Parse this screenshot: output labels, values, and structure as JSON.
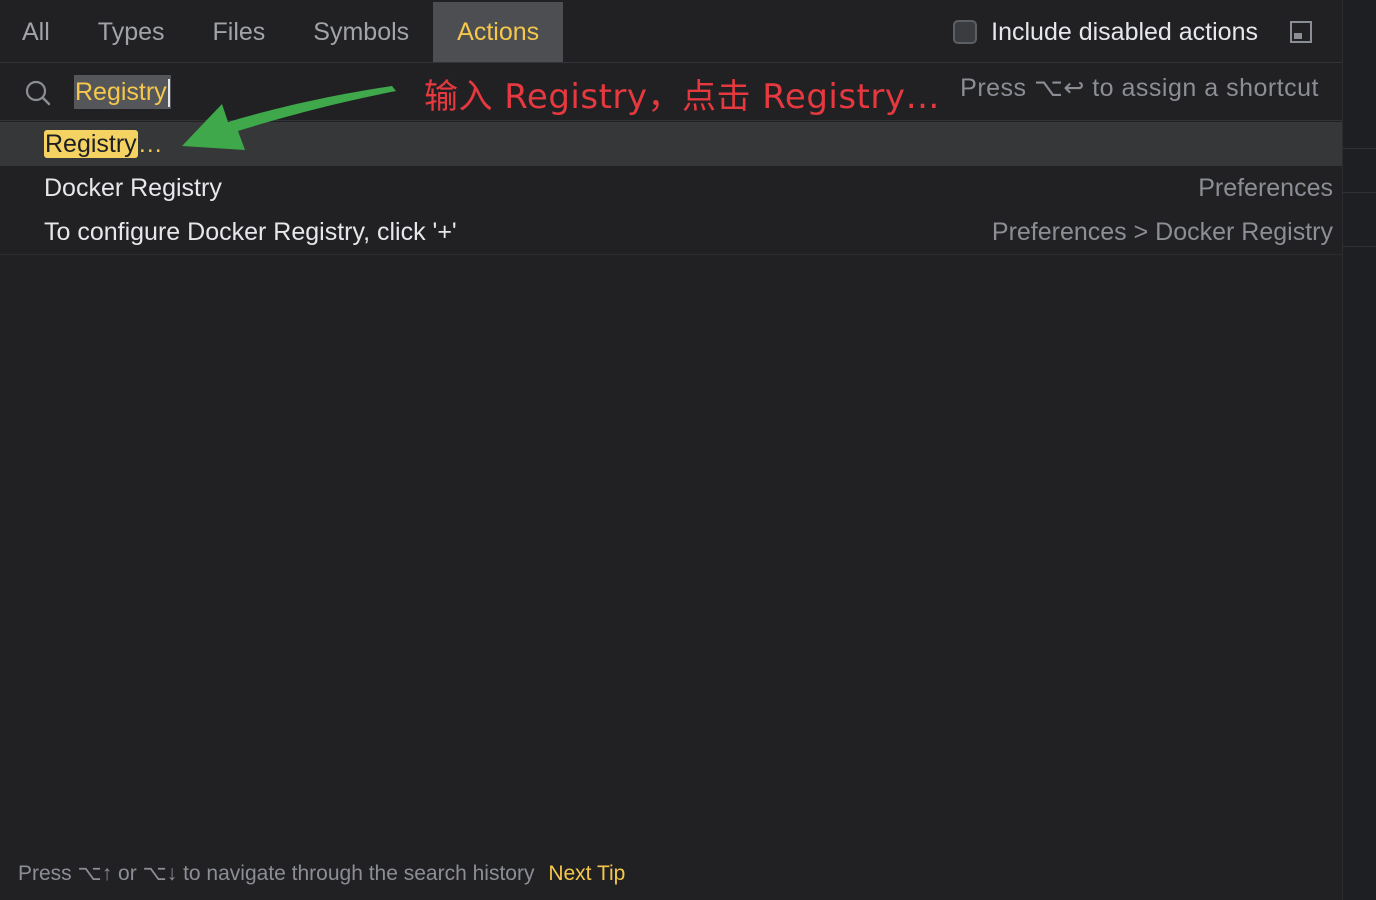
{
  "tabs": [
    {
      "label": "All"
    },
    {
      "label": "Types"
    },
    {
      "label": "Files"
    },
    {
      "label": "Symbols"
    },
    {
      "label": "Actions"
    }
  ],
  "include_disabled": {
    "label": "Include disabled actions",
    "checked": false
  },
  "search": {
    "value": "Registry",
    "shortcut_hint": "Press ⌥↩ to assign a shortcut"
  },
  "annotation": {
    "text": "输入 Registry，点击 Registry…",
    "color": "#e5393f"
  },
  "arrow_color": "#3ea84a",
  "results": [
    {
      "match": "Registry",
      "rest": "…",
      "location": ""
    },
    {
      "name": "Docker Registry",
      "location": "Preferences"
    },
    {
      "name": "To configure Docker Registry, click '+'",
      "location": "Preferences > Docker Registry"
    }
  ],
  "footer": {
    "hint": "Press ⌥↑ or ⌥↓ to navigate through the search history",
    "next_tip": "Next Tip"
  },
  "colors": {
    "accent": "#f5c84c",
    "background": "#212124",
    "active_tab": "#4c4e52"
  }
}
